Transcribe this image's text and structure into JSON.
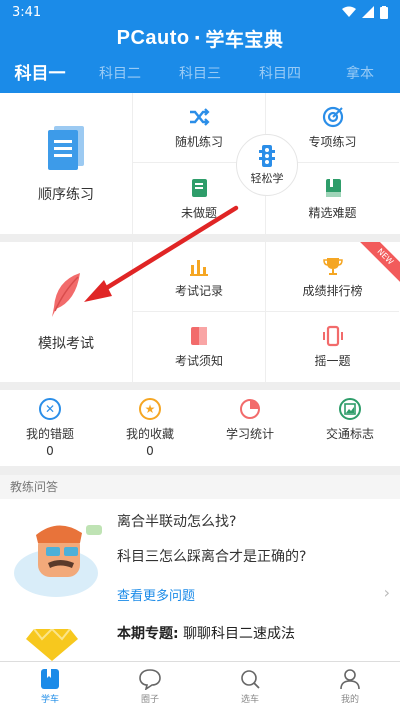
{
  "status": {
    "time": "3:41"
  },
  "app": {
    "brand": "PCauto",
    "dot": "·",
    "subtitle": "学车宝典"
  },
  "tabs": [
    {
      "label": "科目一",
      "active": true
    },
    {
      "label": "科目二",
      "active": false
    },
    {
      "label": "科目三",
      "active": false
    },
    {
      "label": "科目四",
      "active": false
    },
    {
      "label": "拿本",
      "active": false
    }
  ],
  "practice": {
    "sequential": "顺序练习",
    "random": "随机练习",
    "special": "专项练习",
    "undone": "未做题",
    "selected_hard": "精选难题",
    "easy_learn": "轻松学"
  },
  "exam": {
    "mock": "模拟考试",
    "records": "考试记录",
    "ranking": "成绩排行榜",
    "notice": "考试须知",
    "shake": "摇一题",
    "new_tag": "NEW"
  },
  "stats": [
    {
      "label": "我的错题",
      "count": "0"
    },
    {
      "label": "我的收藏",
      "count": "0"
    },
    {
      "label": "学习统计",
      "count": ""
    },
    {
      "label": "交通标志",
      "count": ""
    }
  ],
  "qa": {
    "header": "教练问答",
    "questions": [
      "离合半联动怎么找?",
      "科目三怎么踩离合才是正确的?"
    ],
    "more": "查看更多问题",
    "topic_label": "本期专题",
    "topic_title": "聊聊科目二速成法"
  },
  "bottom_nav": [
    {
      "label": "学车",
      "active": true
    },
    {
      "label": "圈子",
      "active": false
    },
    {
      "label": "选车",
      "active": false
    },
    {
      "label": "我的",
      "active": false
    }
  ],
  "colors": {
    "primary": "#1b8be8",
    "accent_red": "#f25b5b",
    "arrow": "#e02525"
  }
}
